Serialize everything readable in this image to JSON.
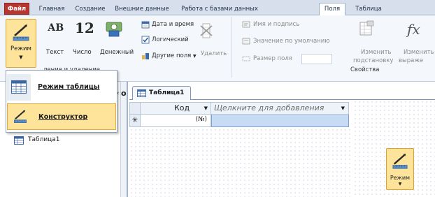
{
  "tabs": {
    "file": "Файл",
    "home": "Главная",
    "create": "Создание",
    "external": "Внешние данные",
    "database": "Работа с базами данных",
    "fields": "Поля",
    "table": "Таблица"
  },
  "ribbon": {
    "view_button": "Режим",
    "add_delete": {
      "text": "Текст",
      "number": "Число",
      "currency": "Денежный",
      "text_icon": "АВ",
      "number_icon": "12",
      "date_time": "Дата и время",
      "logical": "Логический",
      "other_fields": "Другие поля",
      "delete": "Удалить",
      "group_label_partial": "ление и удаление"
    },
    "properties": {
      "name_caption": "Имя и подпись",
      "default_value": "Значение по умолчанию",
      "field_size": "Размер поля",
      "change_lookup_line1": "Изменить",
      "change_lookup_line2": "подстановку",
      "change_expression_line1": "Изменить",
      "change_expression_line2": "выраже",
      "fx": "fx",
      "group_label": "Свойства"
    }
  },
  "view_menu": {
    "datasheet": "Режим таблицы",
    "design": "Конструктор"
  },
  "nav": {
    "table_item": "Таблица1",
    "partial_o": "о"
  },
  "document": {
    "tab_title": "Таблица1",
    "col_id": "Код",
    "col_add": "Щелкните для добавления",
    "new_row_marker": "✳",
    "new_row_value": "(№)"
  },
  "floating_button": {
    "label": "Режим"
  },
  "colors": {
    "file_tab": "#b7362f",
    "highlight": "#fde49a",
    "selection_cell": "#c7dcf4",
    "ribbon_bg": "#f4f7fb"
  }
}
